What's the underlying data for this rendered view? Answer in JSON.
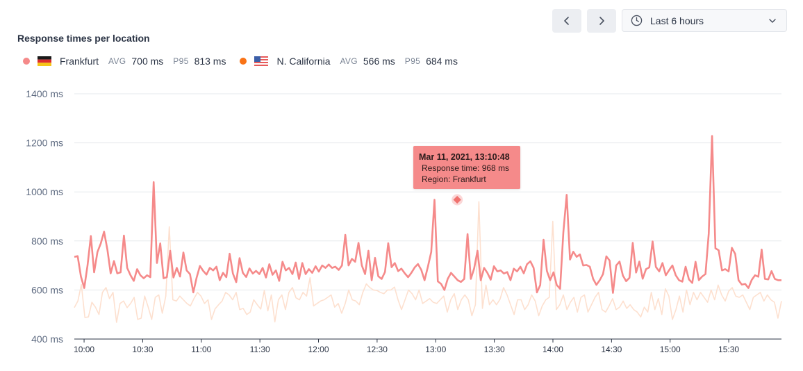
{
  "header": {
    "title": "Response times per location",
    "prev_icon": "chevron-left-icon",
    "next_icon": "chevron-right-icon",
    "time_range": "Last 6 hours",
    "time_range_icon": "clock-icon",
    "dropdown_icon": "chevron-down-icon"
  },
  "legend": [
    {
      "name": "Frankfurt",
      "color": "#f58a8a",
      "flag": "germany-flag",
      "avg_label": "AVG",
      "avg": "700 ms",
      "p95_label": "P95",
      "p95": "813 ms"
    },
    {
      "name": "N. California",
      "color": "#f97316",
      "flag": "usa-flag",
      "avg_label": "AVG",
      "avg": "566 ms",
      "p95_label": "P95",
      "p95": "684 ms"
    }
  ],
  "tooltip": {
    "time": "Mar 11, 2021, 13:10:48",
    "line1": "Response time: 968 ms",
    "line2": "Region: Frankfurt"
  },
  "chart_data": {
    "type": "line",
    "y_tick_labels": [
      "400 ms",
      "600 ms",
      "800 ms",
      "1000 ms",
      "1200 ms",
      "1400 ms"
    ],
    "y_ticks": [
      400,
      600,
      800,
      1000,
      1200,
      1400
    ],
    "ylim": [
      400,
      1400
    ],
    "x_tick_labels": [
      "10:00",
      "10:30",
      "11:00",
      "11:30",
      "12:00",
      "12:30",
      "13:00",
      "13:30",
      "14:00",
      "14:30",
      "15:00",
      "15:30"
    ],
    "x_ticks_min": [
      600,
      630,
      660,
      690,
      720,
      750,
      780,
      810,
      840,
      870,
      900,
      930
    ],
    "xlim_min": [
      595,
      957
    ],
    "grid": true,
    "highlight": {
      "series": "Frankfurt",
      "x_min": 791,
      "value": 968
    },
    "series": [
      {
        "name": "Frankfurt",
        "color": "#f58a8a",
        "x_min": [
          595,
          597,
          600,
          602,
          604,
          607,
          609,
          611,
          614,
          616,
          619,
          621,
          623,
          626,
          628,
          630,
          633,
          635,
          637,
          640,
          642,
          645,
          647,
          649,
          652,
          654,
          656,
          659,
          661,
          664,
          666,
          668,
          671,
          673,
          675,
          678,
          680,
          683,
          685,
          687,
          690,
          692,
          694,
          697,
          699,
          702,
          704,
          706,
          709,
          711,
          713,
          716,
          718,
          721,
          723,
          725,
          728,
          730,
          732,
          735,
          737,
          740,
          742,
          744,
          747,
          749,
          751,
          754,
          756,
          759,
          761,
          763,
          766,
          768,
          770,
          773,
          775,
          778,
          780,
          782,
          785,
          787,
          789,
          792,
          794,
          797,
          799,
          801,
          804,
          806,
          808,
          811,
          813,
          816,
          818,
          820,
          823,
          825,
          827,
          830,
          832,
          835,
          837,
          839,
          842,
          844,
          846,
          849,
          851,
          854,
          856,
          858,
          861,
          863,
          865,
          868,
          870,
          873,
          875,
          877,
          880,
          882,
          884,
          887,
          889,
          892,
          894,
          896,
          899,
          901,
          903,
          906,
          908,
          911,
          913,
          915,
          918,
          920,
          922,
          925,
          927,
          930,
          932,
          934,
          937,
          939,
          941,
          944,
          946,
          949,
          951,
          953,
          956
        ],
        "values": [
          735,
          738,
          655,
          608,
          700,
          820,
          672,
          755,
          790,
          838,
          765,
          668,
          718,
          668,
          672,
          822,
          690,
          660,
          637,
          685,
          660,
          648,
          660,
          652,
          1040,
          710,
          790,
          648,
          652,
          760,
          651,
          690,
          655,
          753,
          680,
          665,
          590,
          650,
          698,
          678,
          663,
          690,
          680,
          695,
          640,
          670,
          652,
          748,
          667,
          632,
          730,
          670,
          653,
          688,
          667,
          678,
          665,
          690,
          651,
          705,
          662,
          680,
          637,
          715,
          680,
          690,
          665,
          712,
          645,
          710,
          665,
          685,
          670,
          697,
          675,
          700,
          690,
          704,
          690,
          695,
          682,
          700,
          825,
          700,
          727,
          715,
          792,
          700,
          665,
          760,
          640,
          731,
          656,
          645,
          673,
          791,
          693,
          710,
          677,
          687,
          668,
          652,
          670,
          692,
          706,
          682,
          640,
          695,
          755,
          968,
          635,
          625,
          600,
          645,
          670,
          655,
          640,
          633,
          645,
          828,
          645,
          688,
          760,
          640,
          690,
          670,
          642,
          697,
          676,
          680,
          667,
          673,
          640,
          687,
          676,
          695,
          668,
          705,
          717,
          690,
          590,
          620,
          805,
          678,
          640,
          672,
          620,
          605,
          835,
          988,
          724,
          756,
          735,
          745,
          700,
          702,
          695,
          645,
          621,
          640,
          665,
          737,
          720,
          588,
          700,
          716,
          659,
          636,
          650,
          792,
          671,
          716,
          646,
          685,
          692,
          798,
          694,
          676,
          710,
          660,
          681,
          700,
          660,
          640,
          634,
          695,
          643,
          629,
          715,
          640,
          655,
          665,
          830,
          1228,
          770,
          762,
          680,
          685,
          676,
          772,
          747,
          640,
          622,
          625,
          608,
          641,
          660,
          654,
          765,
          645,
          643,
          677,
          645,
          640,
          640
        ],
        "x_min_full": []
      },
      {
        "name": "N. California",
        "color": "#fde0cf",
        "values": [
          528,
          555,
          622,
          488,
          490,
          550,
          530,
          500,
          590,
          610,
          565,
          590,
          468,
          545,
          555,
          528,
          545,
          570,
          480,
          485,
          575,
          530,
          480,
          570,
          580,
          505,
          575,
          858,
          560,
          555,
          575,
          560,
          545,
          535,
          565,
          590,
          575,
          545,
          560,
          480,
          523,
          540,
          555,
          590,
          580,
          560,
          590,
          520,
          525,
          500,
          510,
          560,
          540,
          522,
          598,
          515,
          580,
          470,
          560,
          580,
          520,
          590,
          610,
          568,
          560,
          590,
          575,
          650,
          535,
          545,
          555,
          560,
          570,
          580,
          530,
          545,
          505,
          545,
          600,
          560,
          555,
          540,
          590,
          625,
          610,
          600,
          598,
          590,
          585,
          600,
          600,
          612,
          560,
          520,
          560,
          600,
          585,
          560,
          600,
          545,
          555,
          565,
          550,
          545,
          560,
          575,
          510,
          560,
          585,
          520,
          560,
          580,
          560,
          495,
          540,
          960,
          525,
          620,
          540,
          560,
          540,
          562,
          610,
          580,
          540,
          500,
          560,
          560,
          520,
          540,
          580,
          555,
          495,
          535,
          560,
          570,
          880,
          520,
          540,
          580,
          520,
          550,
          570,
          510,
          570,
          580,
          510,
          540,
          570,
          590,
          520,
          510,
          535,
          565,
          520,
          530,
          555,
          525,
          540,
          520,
          510,
          490,
          530,
          510,
          590,
          520,
          565,
          500,
          605,
          575,
          480,
          520,
          575,
          510,
          600,
          540,
          590,
          560,
          590,
          570,
          550,
          600,
          560,
          620,
          580,
          555,
          595,
          610,
          575,
          570,
          580,
          550,
          520,
          570,
          580,
          590,
          555,
          580,
          560,
          550,
          485,
          555
        ]
      }
    ]
  }
}
